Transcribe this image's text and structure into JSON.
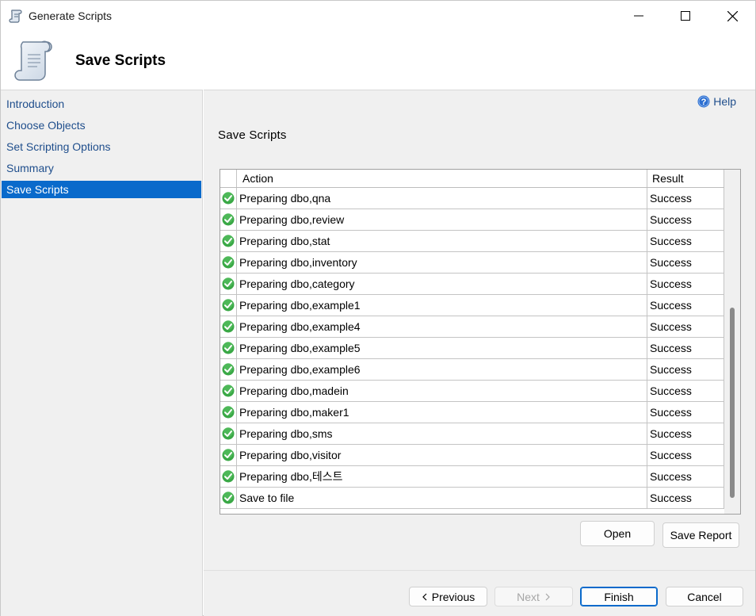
{
  "window": {
    "title": "Generate Scripts",
    "minimize_icon": "minimize-icon",
    "maximize_icon": "maximize-icon",
    "close_icon": "close-icon"
  },
  "header": {
    "heading": "Save Scripts",
    "icon": "script-scroll-icon"
  },
  "nav": {
    "items": [
      {
        "label": "Introduction"
      },
      {
        "label": "Choose Objects"
      },
      {
        "label": "Set Scripting Options"
      },
      {
        "label": "Summary"
      },
      {
        "label": "Save Scripts",
        "active": true
      }
    ]
  },
  "main": {
    "help_label": "Help",
    "section_title": "Save Scripts",
    "columns": {
      "action": "Action",
      "result": "Result"
    },
    "rows": [
      {
        "action": "Preparing dbo,qna",
        "result": "Success"
      },
      {
        "action": "Preparing dbo,review",
        "result": "Success"
      },
      {
        "action": "Preparing dbo,stat",
        "result": "Success"
      },
      {
        "action": "Preparing dbo,inventory",
        "result": "Success"
      },
      {
        "action": "Preparing dbo,category",
        "result": "Success"
      },
      {
        "action": "Preparing dbo,example1",
        "result": "Success"
      },
      {
        "action": "Preparing dbo,example4",
        "result": "Success"
      },
      {
        "action": "Preparing dbo,example5",
        "result": "Success"
      },
      {
        "action": "Preparing dbo,example6",
        "result": "Success"
      },
      {
        "action": "Preparing dbo,madein",
        "result": "Success"
      },
      {
        "action": "Preparing dbo,maker1",
        "result": "Success"
      },
      {
        "action": "Preparing dbo,sms",
        "result": "Success"
      },
      {
        "action": "Preparing dbo,visitor",
        "result": "Success"
      },
      {
        "action": "Preparing dbo,테스트",
        "result": "Success"
      },
      {
        "action": "Save to file",
        "result": "Success"
      }
    ],
    "open_label": "Open",
    "save_report_label": "Save Report"
  },
  "footer": {
    "previous_label": "Previous",
    "next_label": "Next",
    "finish_label": "Finish",
    "cancel_label": "Cancel"
  },
  "colors": {
    "accent": "#0a6acb",
    "link": "#1f4e8c",
    "success": "#3aa846"
  }
}
